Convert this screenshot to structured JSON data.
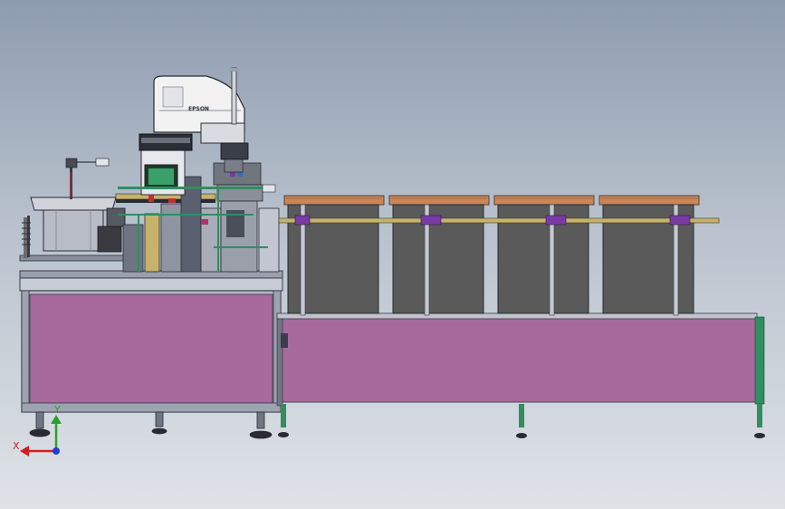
{
  "viewport": {
    "background_top": "#8e9cb0",
    "background_bottom": "#dfe3e8"
  },
  "robot": {
    "brand_label": "EPSON",
    "body_color": "#f2f2f2"
  },
  "colors": {
    "frame_panel": "#a86a9c",
    "frame_edge": "#4a4a5a",
    "bins": "#5a5a5a",
    "tray_top": "#c9865a",
    "guide_bracket": "#7a3aa6",
    "leg_green": "#2f8f5f",
    "hmi_screen": "#3aa06a",
    "gold_rail": "#c6b26a"
  },
  "components": {
    "bins": [
      {
        "name": "bin-1"
      },
      {
        "name": "bin-2"
      },
      {
        "name": "bin-3"
      },
      {
        "name": "bin-4"
      }
    ]
  },
  "triad": {
    "x_label": "X",
    "y_label": "Y",
    "x_color": "#d02020",
    "y_color": "#2aa02a",
    "z_color": "#2040d0"
  }
}
